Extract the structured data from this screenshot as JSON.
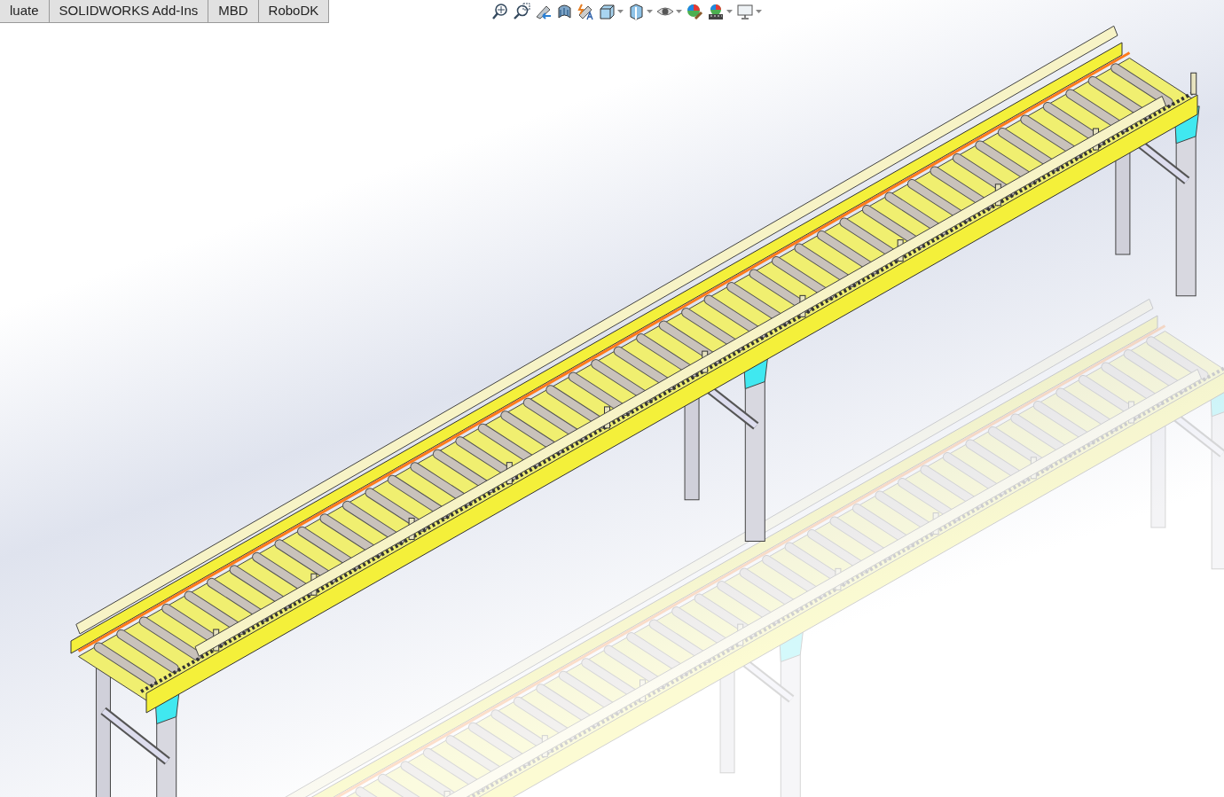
{
  "tabs": [
    {
      "label": "luate"
    },
    {
      "label": "SOLIDWORKS Add-Ins"
    },
    {
      "label": "MBD"
    },
    {
      "label": "RoboDK"
    }
  ],
  "view_toolbar": [
    {
      "kind": "zoom-fit",
      "has_dropdown": false
    },
    {
      "kind": "zoom-area",
      "has_dropdown": false
    },
    {
      "kind": "previous-view",
      "has_dropdown": false
    },
    {
      "kind": "section-view",
      "has_dropdown": false
    },
    {
      "kind": "dynamic-annotation",
      "has_dropdown": false
    },
    {
      "kind": "view-orientation",
      "has_dropdown": true
    },
    {
      "kind": "display-style",
      "has_dropdown": true
    },
    {
      "kind": "hide-show",
      "has_dropdown": true
    },
    {
      "kind": "edit-appearance",
      "has_dropdown": false
    },
    {
      "kind": "scenes",
      "has_dropdown": true
    },
    {
      "kind": "view-settings",
      "has_dropdown": true
    }
  ]
}
